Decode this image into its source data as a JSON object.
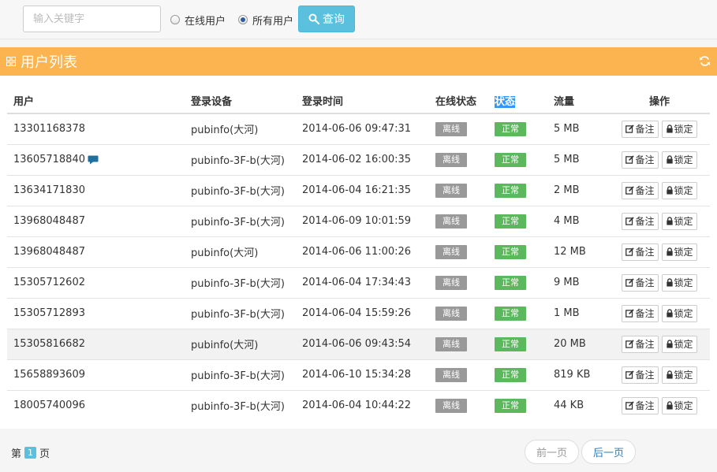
{
  "search": {
    "placeholder": "输入关键字",
    "value": ""
  },
  "filters": [
    {
      "label": "在线用户",
      "checked": false
    },
    {
      "label": "所有用户",
      "checked": true
    }
  ],
  "query_label": "查询",
  "panel": {
    "title": "用户列表"
  },
  "table": {
    "headers": [
      "用户",
      "登录设备",
      "登录时间",
      "在线状态",
      "状态",
      "流量",
      "操作"
    ],
    "rows": [
      {
        "user": "13301168378",
        "device": "pubinfo(大河)",
        "time": "2014-06-06 09:47:31",
        "online": "离线",
        "status": "正常",
        "flow": "5 MB"
      },
      {
        "user": "13605718840",
        "device": "pubinfo-3F-b(大河)",
        "time": "2014-06-02 16:00:35",
        "online": "离线",
        "status": "正常",
        "flow": "5 MB"
      },
      {
        "user": "13634171830",
        "device": "pubinfo-3F-b(大河)",
        "time": "2014-06-04 16:21:35",
        "online": "离线",
        "status": "正常",
        "flow": "2 MB"
      },
      {
        "user": "13968048487",
        "device": "pubinfo-3F-b(大河)",
        "time": "2014-06-09 10:01:59",
        "online": "离线",
        "status": "正常",
        "flow": "4 MB"
      },
      {
        "user": "13968048487",
        "device": "pubinfo(大河)",
        "time": "2014-06-06 11:00:26",
        "online": "离线",
        "status": "正常",
        "flow": "12 MB"
      },
      {
        "user": "15305712602",
        "device": "pubinfo-3F-b(大河)",
        "time": "2014-06-04 17:34:43",
        "online": "离线",
        "status": "正常",
        "flow": "9 MB"
      },
      {
        "user": "15305712893",
        "device": "pubinfo-3F-b(大河)",
        "time": "2014-06-04 15:59:26",
        "online": "离线",
        "status": "正常",
        "flow": "1 MB"
      },
      {
        "user": "15305816682",
        "device": "pubinfo(大河)",
        "time": "2014-06-06 09:43:54",
        "online": "离线",
        "status": "正常",
        "flow": "20 MB"
      },
      {
        "user": "15658893609",
        "device": "pubinfo-3F-b(大河)",
        "time": "2014-06-10 15:34:28",
        "online": "离线",
        "status": "正常",
        "flow": "819 KB"
      },
      {
        "user": "18005740096",
        "device": "pubinfo-3F-b(大河)",
        "time": "2014-06-04 10:44:22",
        "online": "离线",
        "status": "正常",
        "flow": "44 KB"
      }
    ],
    "note_label": "备注",
    "lock_label": "锁定"
  },
  "pagination": {
    "prefix": "第",
    "current": "1",
    "suffix": "页",
    "prev_label": "前一页",
    "next_label": "后一页"
  },
  "colors": {
    "accent": "#fbb450",
    "info": "#5bc0de",
    "success": "#5cb85c",
    "offline": "#999999",
    "link": "#337ab7"
  },
  "icons": {
    "search": "search-icon",
    "grid": "grid-icon",
    "refresh": "refresh-icon",
    "comment": "comment-icon",
    "edit": "edit-icon",
    "lock": "lock-icon"
  }
}
